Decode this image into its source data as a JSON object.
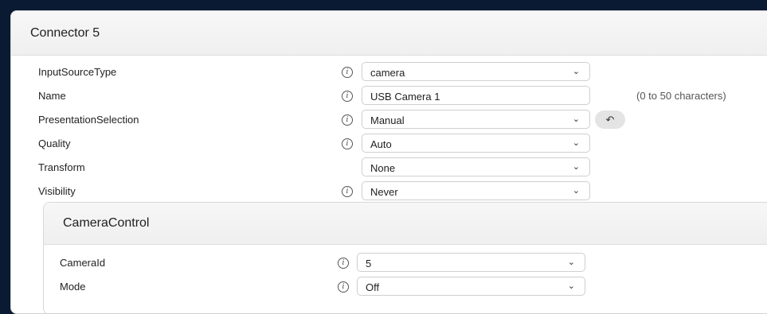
{
  "connector": {
    "title": "Connector 5",
    "rows": [
      {
        "label": "InputSourceType",
        "value": "camera",
        "type": "select"
      },
      {
        "label": "Name",
        "value": "USB Camera 1",
        "type": "text",
        "hint": "(0 to 50 characters)"
      },
      {
        "label": "PresentationSelection",
        "value": "Manual",
        "type": "select"
      },
      {
        "label": "Quality",
        "value": "Auto",
        "type": "select"
      },
      {
        "label": "Transform",
        "value": "None",
        "type": "select"
      },
      {
        "label": "Visibility",
        "value": "Never",
        "type": "select"
      }
    ]
  },
  "camera_control": {
    "title": "CameraControl",
    "rows": [
      {
        "label": "CameraId",
        "value": "5",
        "type": "select"
      },
      {
        "label": "Mode",
        "value": "Off",
        "type": "select"
      }
    ]
  },
  "icons": {
    "info": "info-icon",
    "chevron": "chevron-down-icon",
    "revert": "undo-icon"
  }
}
